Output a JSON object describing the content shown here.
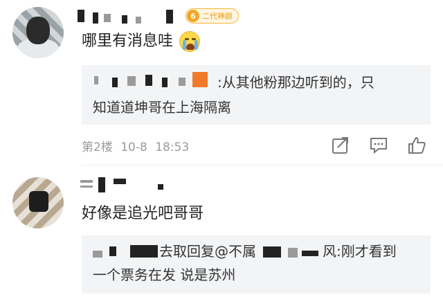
{
  "comments": [
    {
      "text": "哪里有消息哇",
      "badge": {
        "level": "6",
        "label": "二代神颜",
        "color": "#f5a623"
      },
      "emoji_icon": "crying-emoji-icon",
      "reply": {
        "line1": ":从其他粉那边听到的，只",
        "line2": "知道道坤哥在上海隔离"
      },
      "floor": "第2楼",
      "date": "10-8",
      "time": "18:53"
    },
    {
      "text": "好像是追光吧哥哥",
      "reply": {
        "line1_prefix": "去取回复@不属",
        "line1_suffix": "风:刚才看到",
        "line2": "一个票务在发 说是苏州"
      }
    }
  ],
  "actions": {
    "share_icon": "share-icon",
    "comment_icon": "comment-icon",
    "like_icon": "like-icon"
  },
  "colors": {
    "meta_text": "#9b9b9b",
    "reply_bg": "#f3f4f6",
    "badge": "#f5a623"
  }
}
